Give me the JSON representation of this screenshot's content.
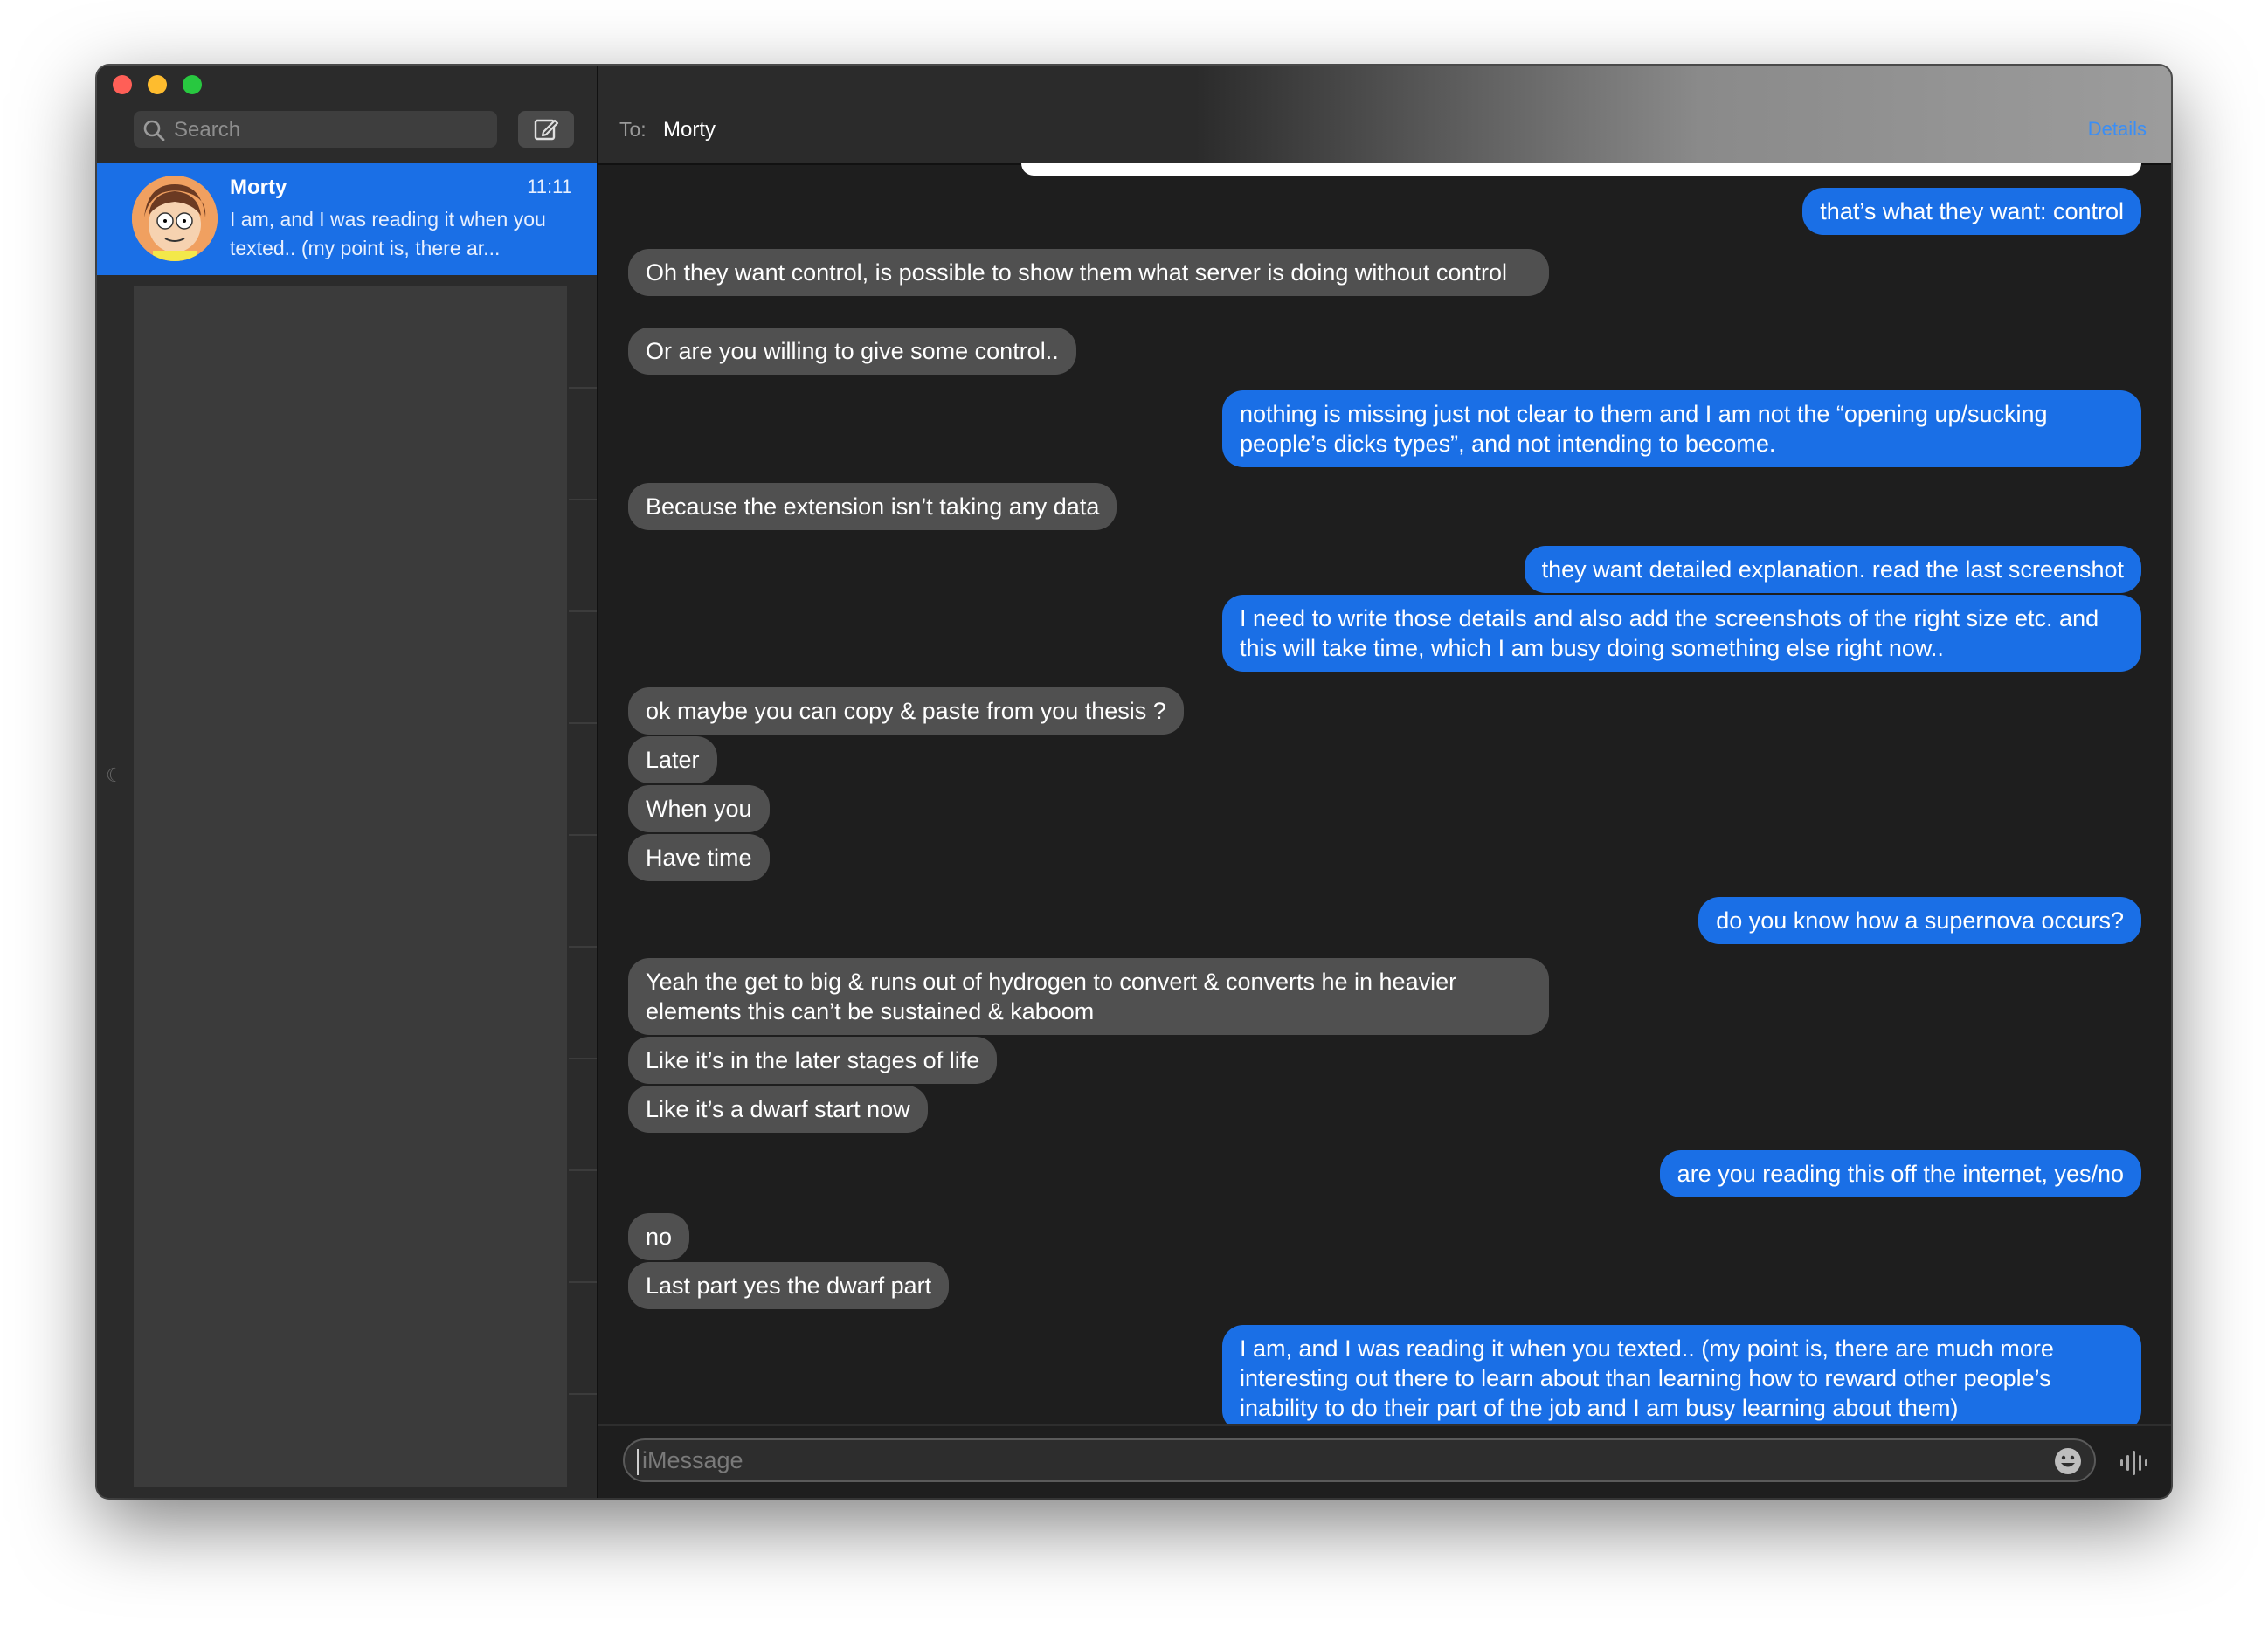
{
  "sidebar": {
    "search_placeholder": "Search",
    "conversation": {
      "name": "Morty",
      "time": "11:11",
      "preview": "I am, and I was reading it when you texted.. (my point is, there ar..."
    }
  },
  "header": {
    "to_label": "To:",
    "recipient": "Morty",
    "details": "Details"
  },
  "messages": [
    {
      "dir": "out",
      "text": "that’s what they want: control"
    },
    {
      "dir": "in",
      "text": "Oh they want control, is possible to show them what server is doing without control"
    },
    {
      "dir": "in",
      "text": "Or are you willing to give some control.."
    },
    {
      "dir": "out",
      "text": "nothing is missing just not clear to them and I am not the “opening up/sucking people’s dicks types”, and not intending to become."
    },
    {
      "dir": "in",
      "text": "Because the extension isn’t taking any data"
    },
    {
      "dir": "out",
      "text": "they want detailed explanation. read the last screenshot"
    },
    {
      "dir": "out",
      "text": "I need to write those details and also add the screenshots of the right size etc. and this will take time, which I am busy doing something else right now.."
    },
    {
      "dir": "in",
      "text": "ok maybe you can copy & paste from you thesis ?"
    },
    {
      "dir": "in",
      "text": "Later"
    },
    {
      "dir": "in",
      "text": "When you"
    },
    {
      "dir": "in",
      "text": "Have time"
    },
    {
      "dir": "out",
      "text": "do you know how a supernova occurs?"
    },
    {
      "dir": "in",
      "text": "Yeah the get to big & runs out of hydrogen to convert & converts he in heavier elements this can’t be sustained & kaboom"
    },
    {
      "dir": "in",
      "text": "Like it’s in the later stages of life"
    },
    {
      "dir": "in",
      "text": "Like it’s a dwarf start now"
    },
    {
      "dir": "out",
      "text": "are you reading this off the internet, yes/no"
    },
    {
      "dir": "in",
      "text": "no"
    },
    {
      "dir": "in",
      "text": "Last part yes the dwarf part"
    },
    {
      "dir": "out",
      "text": "I am, and I was reading it when you texted.. (my point is, there are much more interesting out there to learn about than learning how to reward other people’s inability to do their part of the job and I am busy learning about them)"
    }
  ],
  "input": {
    "placeholder": "iMessage"
  },
  "colors": {
    "outgoing_bubble": "#1a6fe6",
    "incoming_bubble": "#505050",
    "selected_conversation": "#1a6fe6"
  },
  "icons": [
    "search-icon",
    "compose-icon",
    "emoji-icon",
    "audio-waveform-icon",
    "moon-icon"
  ]
}
